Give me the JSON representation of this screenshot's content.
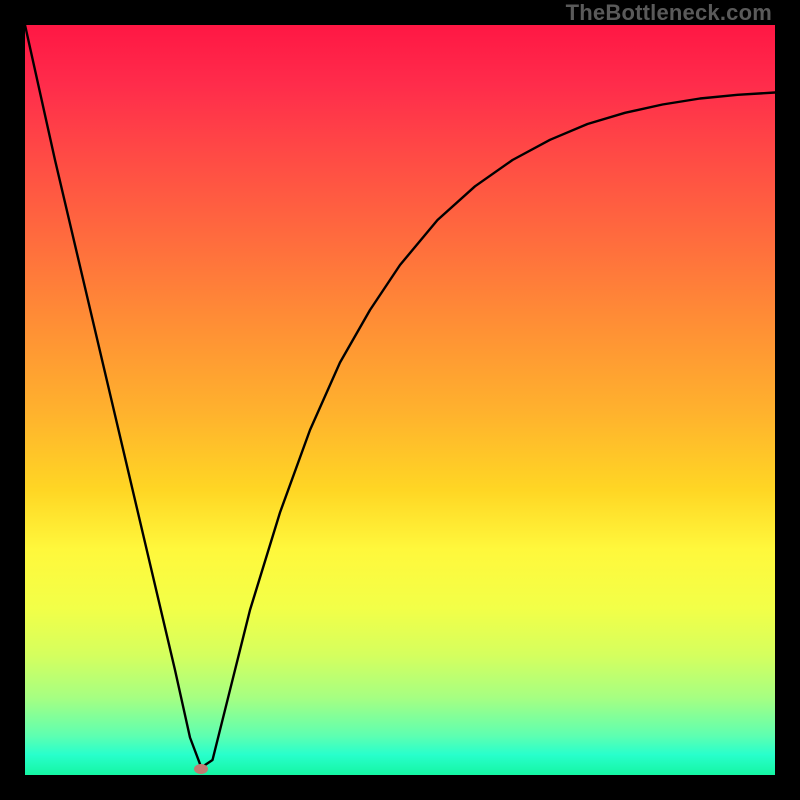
{
  "watermark": "TheBottleneck.com",
  "chart_data": {
    "type": "line",
    "title": "",
    "xlabel": "",
    "ylabel": "",
    "xlim": [
      0,
      100
    ],
    "ylim": [
      0,
      100
    ],
    "grid": false,
    "legend": false,
    "series": [
      {
        "name": "bottleneck-curve",
        "x": [
          0,
          4,
          8,
          12,
          16,
          20,
          22,
          23.5,
          25,
          27,
          30,
          34,
          38,
          42,
          46,
          50,
          55,
          60,
          65,
          70,
          75,
          80,
          85,
          90,
          95,
          100
        ],
        "y": [
          100,
          82,
          65,
          48,
          31,
          14,
          5,
          1,
          2,
          10,
          22,
          35,
          46,
          55,
          62,
          68,
          74,
          78.5,
          82,
          84.7,
          86.8,
          88.3,
          89.4,
          90.2,
          90.7,
          91
        ]
      }
    ],
    "marker": {
      "x": 23.5,
      "y": 0.8
    },
    "background_gradient": {
      "top": "#ff1744",
      "upper_mid": "#ff8f35",
      "mid": "#ffd624",
      "lower_mid": "#f2ff48",
      "bottom": "#15f6a3"
    }
  }
}
